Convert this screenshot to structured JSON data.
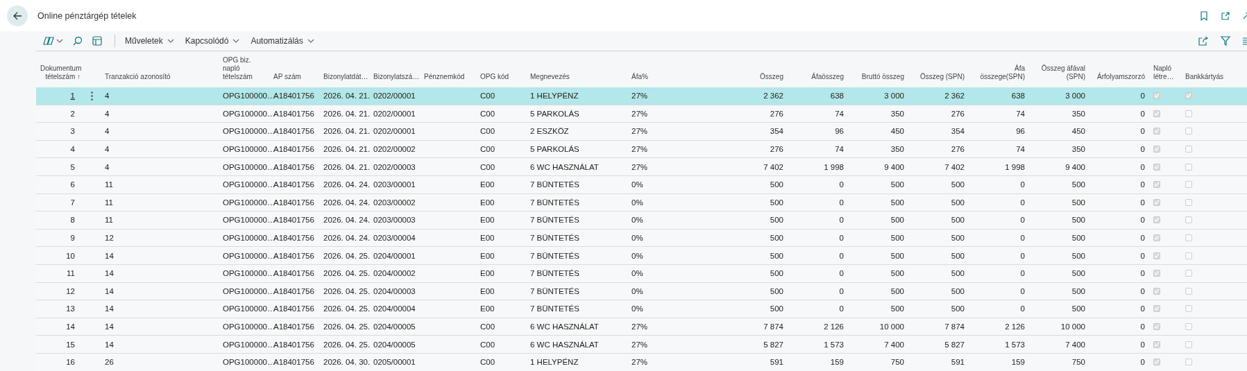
{
  "page": {
    "title": "Online pénztárgép tételek"
  },
  "toolbar": {
    "actions": [
      {
        "label": "Műveletek"
      },
      {
        "label": "Kapcsolódó"
      },
      {
        "label": "Automatizálás"
      }
    ]
  },
  "table": {
    "columns": [
      {
        "label": "Dokumentum tételszám ↑",
        "kind": "number"
      },
      {
        "label": "Tranzakció azonosító",
        "kind": "text"
      },
      {
        "label": "OPG biz. napló tételszám",
        "kind": "text"
      },
      {
        "label": "AP szám",
        "kind": "text"
      },
      {
        "label": "Bizonylatdát…",
        "kind": "text"
      },
      {
        "label": "Bizonylatszá…",
        "kind": "text"
      },
      {
        "label": "Pénznemkód",
        "kind": "text"
      },
      {
        "label": "OPG kód",
        "kind": "text"
      },
      {
        "label": "Megnevezés",
        "kind": "text"
      },
      {
        "label": "Áfa%",
        "kind": "text"
      },
      {
        "label": "Összeg",
        "kind": "number"
      },
      {
        "label": "Áfaösszeg",
        "kind": "number"
      },
      {
        "label": "Bruttó összeg",
        "kind": "number"
      },
      {
        "label": "Összeg (SPN)",
        "kind": "number"
      },
      {
        "label": "Áfa összege(SPN)",
        "kind": "number"
      },
      {
        "label": "Összeg áfával (SPN)",
        "kind": "number"
      },
      {
        "label": "Árfolyamszorzó",
        "kind": "number"
      },
      {
        "label": "Napló létre…",
        "kind": "check"
      },
      {
        "label": "Bankkártyás",
        "kind": "check"
      }
    ],
    "rows": [
      {
        "selected": true,
        "cells": [
          "1",
          "4",
          "OPG100000…",
          "A18401756",
          "2026. 04. 21.",
          "0202/00001",
          null,
          "C00",
          "1 HELYPÉNZ",
          "27%",
          "2 362",
          "638",
          "3 000",
          "2 362",
          "638",
          "3 000",
          "0"
        ],
        "journal_created": true,
        "card": true
      },
      {
        "selected": false,
        "cells": [
          "2",
          "4",
          "OPG100000…",
          "A18401756",
          "2026. 04. 21.",
          "0202/00001",
          null,
          "C00",
          "5 PARKOLÁS",
          "27%",
          "276",
          "74",
          "350",
          "276",
          "74",
          "350",
          "0"
        ],
        "journal_created": true,
        "card": false
      },
      {
        "selected": false,
        "cells": [
          "3",
          "4",
          "OPG100000…",
          "A18401756",
          "2026. 04. 21.",
          "0202/00001",
          null,
          "C00",
          "2 ESZKÖZ",
          "27%",
          "354",
          "96",
          "450",
          "354",
          "96",
          "450",
          "0"
        ],
        "journal_created": true,
        "card": false
      },
      {
        "selected": false,
        "cells": [
          "4",
          "4",
          "OPG100000…",
          "A18401756",
          "2026. 04. 21.",
          "0202/00002",
          null,
          "C00",
          "5 PARKOLÁS",
          "27%",
          "276",
          "74",
          "350",
          "276",
          "74",
          "350",
          "0"
        ],
        "journal_created": true,
        "card": false
      },
      {
        "selected": false,
        "cells": [
          "5",
          "4",
          "OPG100000…",
          "A18401756",
          "2026. 04. 21.",
          "0202/00003",
          null,
          "C00",
          "6 WC HASZNÁLAT",
          "27%",
          "7 402",
          "1 998",
          "9 400",
          "7 402",
          "1 998",
          "9 400",
          "0"
        ],
        "journal_created": true,
        "card": false
      },
      {
        "selected": false,
        "cells": [
          "6",
          "11",
          "OPG100000…",
          "A18401756",
          "2026. 04. 24.",
          "0203/00001",
          null,
          "E00",
          "7 BÜNTETÉS",
          "0%",
          "500",
          "0",
          "500",
          "500",
          "0",
          "500",
          "0"
        ],
        "journal_created": true,
        "card": false
      },
      {
        "selected": false,
        "cells": [
          "7",
          "11",
          "OPG100000…",
          "A18401756",
          "2026. 04. 24.",
          "0203/00002",
          null,
          "E00",
          "7 BÜNTETÉS",
          "0%",
          "500",
          "0",
          "500",
          "500",
          "0",
          "500",
          "0"
        ],
        "journal_created": true,
        "card": false
      },
      {
        "selected": false,
        "cells": [
          "8",
          "11",
          "OPG100000…",
          "A18401756",
          "2026. 04. 24.",
          "0203/00003",
          null,
          "E00",
          "7 BÜNTETÉS",
          "0%",
          "500",
          "0",
          "500",
          "500",
          "0",
          "500",
          "0"
        ],
        "journal_created": true,
        "card": false
      },
      {
        "selected": false,
        "cells": [
          "9",
          "12",
          "OPG100000…",
          "A18401756",
          "2026. 04. 24.",
          "0203/00004",
          null,
          "E00",
          "7 BÜNTETÉS",
          "0%",
          "500",
          "0",
          "500",
          "500",
          "0",
          "500",
          "0"
        ],
        "journal_created": true,
        "card": false
      },
      {
        "selected": false,
        "cells": [
          "10",
          "14",
          "OPG100000…",
          "A18401756",
          "2026. 04. 25.",
          "0204/00001",
          null,
          "E00",
          "7 BÜNTETÉS",
          "0%",
          "500",
          "0",
          "500",
          "500",
          "0",
          "500",
          "0"
        ],
        "journal_created": true,
        "card": false
      },
      {
        "selected": false,
        "cells": [
          "11",
          "14",
          "OPG100000…",
          "A18401756",
          "2026. 04. 25.",
          "0204/00002",
          null,
          "E00",
          "7 BÜNTETÉS",
          "0%",
          "500",
          "0",
          "500",
          "500",
          "0",
          "500",
          "0"
        ],
        "journal_created": true,
        "card": false
      },
      {
        "selected": false,
        "cells": [
          "12",
          "14",
          "OPG100000…",
          "A18401756",
          "2026. 04. 25.",
          "0204/00003",
          null,
          "E00",
          "7 BÜNTETÉS",
          "0%",
          "500",
          "0",
          "500",
          "500",
          "0",
          "500",
          "0"
        ],
        "journal_created": true,
        "card": false
      },
      {
        "selected": false,
        "cells": [
          "13",
          "14",
          "OPG100000…",
          "A18401756",
          "2026. 04. 25.",
          "0204/00004",
          null,
          "E00",
          "7 BÜNTETÉS",
          "0%",
          "500",
          "0",
          "500",
          "500",
          "0",
          "500",
          "0"
        ],
        "journal_created": true,
        "card": false
      },
      {
        "selected": false,
        "cells": [
          "14",
          "14",
          "OPG100000…",
          "A18401756",
          "2026. 04. 25.",
          "0204/00005",
          null,
          "C00",
          "6 WC HASZNÁLAT",
          "27%",
          "7 874",
          "2 126",
          "10 000",
          "7 874",
          "2 126",
          "10 000",
          "0"
        ],
        "journal_created": true,
        "card": false
      },
      {
        "selected": false,
        "cells": [
          "15",
          "14",
          "OPG100000…",
          "A18401756",
          "2026. 04. 25.",
          "0204/00005",
          null,
          "C00",
          "6 WC HASZNÁLAT",
          "27%",
          "5 827",
          "1 573",
          "7 400",
          "5 827",
          "1 573",
          "7 400",
          "0"
        ],
        "journal_created": true,
        "card": false
      },
      {
        "selected": false,
        "cells": [
          "16",
          "26",
          "OPG100000…",
          "A18401756",
          "2026. 04. 30.",
          "0205/00001",
          null,
          "C00",
          "1 HELYPÉNZ",
          "27%",
          "591",
          "159",
          "750",
          "591",
          "159",
          "750",
          "0"
        ],
        "journal_created": true,
        "card": false
      }
    ]
  }
}
